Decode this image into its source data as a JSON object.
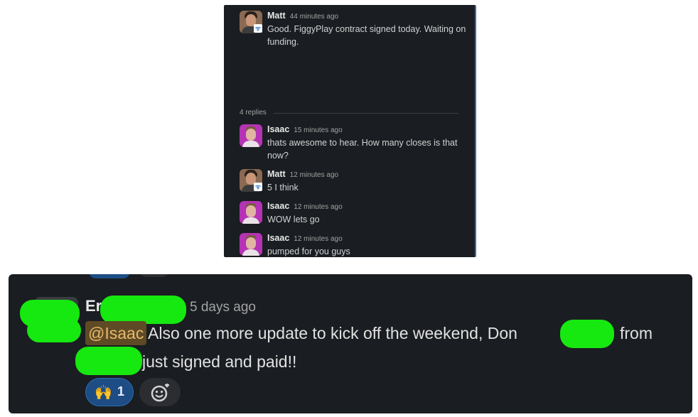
{
  "thread": {
    "root": {
      "author": "Matt",
      "time": "44 minutes ago",
      "text": "Good. FiggyPlay contract signed today. Waiting on funding."
    },
    "replies_label": "4 replies",
    "replies": [
      {
        "author": "Isaac",
        "time": "15 minutes ago",
        "text": "thats awesome to hear. How many closes is that now?",
        "avatar": "isaac-avatar"
      },
      {
        "author": "Matt",
        "time": "12 minutes ago",
        "text": "5 I think",
        "avatar": "matt-avatar"
      },
      {
        "author": "Isaac",
        "time": "12 minutes ago",
        "text": "WOW lets go",
        "avatar": "isaac-avatar"
      },
      {
        "author": "Isaac",
        "time": "12 minutes ago",
        "text": "pumped for you guys",
        "avatar": "isaac-avatar"
      }
    ]
  },
  "message": {
    "author_visible": "Er",
    "time": "5 days ago",
    "mention": "@Isaac",
    "line1": "Also one more update to kick off the weekend, Don",
    "line1_tail": "from",
    "line2": "just signed and paid!!",
    "reaction": {
      "emoji": "🙌",
      "count": "1"
    },
    "add_reaction_icon": "add-emoji-icon"
  },
  "colors": {
    "panel_bg": "#1a1d21",
    "redaction": "#16e90f",
    "mention_bg": "#5e4a25",
    "mention_text": "#e8b86b",
    "reaction_bg": "#1d4d84"
  }
}
